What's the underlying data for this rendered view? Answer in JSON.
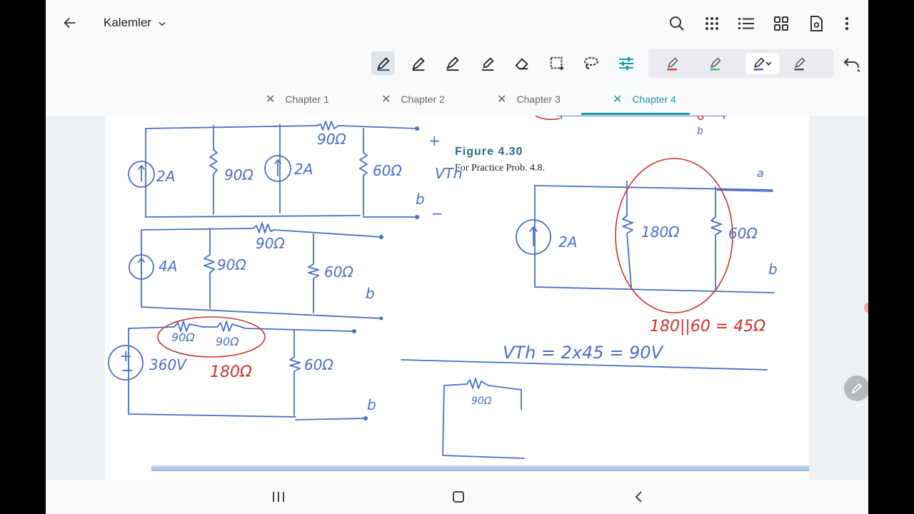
{
  "header": {
    "back_icon": "arrow-left-icon",
    "title": "Kalemler",
    "title_dropdown_icon": "chevron-down-icon",
    "actions": [
      "search-icon",
      "grid-dots-icon",
      "list-icon",
      "apps-icon",
      "page-settings-icon",
      "more-vert-icon"
    ]
  },
  "toolbar": {
    "tools": [
      "pen-icon",
      "pen-icon",
      "pen-icon",
      "highlighter-icon",
      "eraser-icon",
      "select-rect-icon",
      "lasso-icon",
      "sliders-icon"
    ],
    "pens": [
      {
        "icon": "pen-icon",
        "color": "#c62828"
      },
      {
        "icon": "pen-icon",
        "color": "#3aa757"
      },
      {
        "icon": "pen-icon",
        "color": "#2f4f8f"
      },
      {
        "icon": "pen-icon",
        "color": "#333333"
      }
    ],
    "undo_icon": "undo-icon"
  },
  "tabs": [
    {
      "label": "Chapter 1",
      "active": false
    },
    {
      "label": "Chapter 2",
      "active": false
    },
    {
      "label": "Chapter 3",
      "active": false
    },
    {
      "label": "Chapter 4",
      "active": true
    }
  ],
  "page": {
    "figure_title": "Figure 4.30",
    "figure_caption": "For Practice Prob. 4.8.",
    "handwriting": {
      "c1_source": "2A",
      "c1_r1": "90Ω",
      "c1_source2": "2A",
      "c1_r_top": "90Ω",
      "c1_r2": "60Ω",
      "c1_plus": "+",
      "c1_vth": "VTh",
      "c1_b": "b",
      "c1_minus": "−",
      "c2_source": "4A",
      "c2_r1": "90Ω",
      "c2_r_top": "90Ω",
      "c2_r2": "60Ω",
      "c2_b": "b",
      "c3_source": "360V",
      "c3_r_top1": "90Ω",
      "c3_r_top2": "90Ω",
      "c3_red_sum": "180Ω",
      "c3_r2": "60Ω",
      "c3_b": "b",
      "fig_source": "2A",
      "fig_r1": "180Ω",
      "fig_r2": "60Ω",
      "fig_a": "a",
      "fig_b": "b",
      "fig_top_b": "b",
      "parallel_eq": "180||60 = 45Ω",
      "vth_eq": "VTh = 2x45 = 90V",
      "thevenin_r": "90Ω"
    }
  },
  "colors": {
    "ink_blue": "#4a6fc2",
    "ink_red": "#c8332b",
    "accent_teal": "#1a9aa8"
  },
  "bottom_nav": [
    "recents-icon",
    "home-icon",
    "back-icon"
  ],
  "fab_icon": "edit-pencil-icon"
}
